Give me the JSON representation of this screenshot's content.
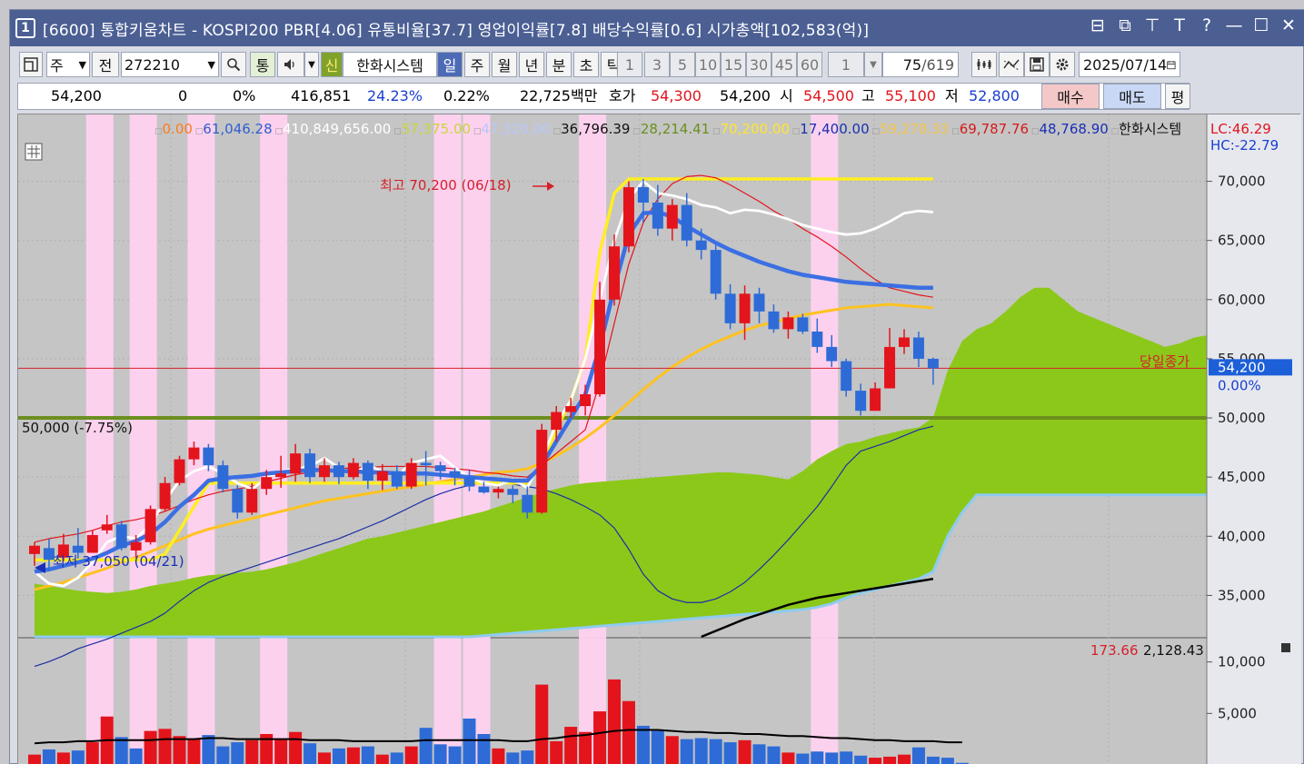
{
  "window": {
    "number": "1",
    "title": "[6600] 통합키움차트 - KOSPI200 PBR[4.06] 유통비율[37.7] 영업이익률[7.8] 배당수익률[0.6] 시가총액[102,583(억)]",
    "controls": [
      "⊟",
      "⧉",
      "⊤",
      "T",
      "?",
      "—",
      "☐",
      "✕"
    ]
  },
  "toolbar": {
    "period_label": "주",
    "prev_label": "전",
    "code_value": "272210",
    "tong_label": "통",
    "shin_label": "신",
    "company_name": "한화시스템",
    "periods": [
      "일",
      "주",
      "월",
      "년",
      "분",
      "초",
      "틱"
    ],
    "active_period": "일",
    "minute_options": [
      "1",
      "3",
      "5",
      "10",
      "15",
      "30",
      "45",
      "60"
    ],
    "count_value": "1",
    "page_position": "75",
    "page_total": "/619",
    "date_value": "2025/07/14"
  },
  "quote": {
    "price": "54,200",
    "change": "0",
    "change_pct": "0%",
    "volume": "416,851",
    "turnover_pct": "24.23%",
    "ratio_pct": "0.22%",
    "amount": "22,725백만",
    "ask_label": "호가",
    "ask_value": "54,300",
    "bid_value": "54,200",
    "open_label": "시",
    "open_value": "54,500",
    "high_label": "고",
    "high_value": "55,100",
    "low_label": "저",
    "low_value": "52,800",
    "buy_label": "매수",
    "sell_label": "매도",
    "even_label": "평"
  },
  "legend": {
    "items": [
      {
        "text": "0.00",
        "color": "#ff7b1c"
      },
      {
        "text": "61,046.28",
        "color": "#2f5fd0"
      },
      {
        "text": "410,849,656.00",
        "color": "#ffffff"
      },
      {
        "text": "57,375.00",
        "color": "#c9d63a"
      },
      {
        "text": "47,320.00",
        "color": "#b9c7ff"
      },
      {
        "text": "36,796.39",
        "color": "#111111"
      },
      {
        "text": "28,214.41",
        "color": "#6b8f1e"
      },
      {
        "text": "70,200.00",
        "color": "#ffe62b"
      },
      {
        "text": "17,400.00",
        "color": "#1a2fb5"
      },
      {
        "text": "59,278.33",
        "color": "#f2c44a"
      },
      {
        "text": "69,787.76",
        "color": "#d61a1a"
      },
      {
        "text": "48,768.90",
        "color": "#1a2fb5"
      },
      {
        "text": "한화시스템",
        "color": "#111111"
      }
    ],
    "lc": "LC:46.29",
    "hc": "HC:-22.79"
  },
  "annotations": {
    "high": "최고 70,200 (06/18)",
    "low": "최저 37,050 (04/21)",
    "level": "50,000 (-7.75%)",
    "close_label": "당일종가",
    "last_price": "54,200",
    "last_pct": "0.00%",
    "volume_legend_a": "173.66",
    "volume_legend_b": "2,128.43"
  },
  "axis": {
    "price_ticks": [
      "70,000",
      "65,000",
      "60,000",
      "55,000",
      "50,000",
      "45,000",
      "40,000",
      "35,000"
    ],
    "volume_ticks": [
      "10,000",
      "5,000"
    ]
  },
  "chart_data": {
    "type": "candlestick",
    "price_range": [
      31500,
      73500
    ],
    "volume_max": 12000,
    "candles": [
      [
        38500,
        39200,
        37500,
        39500
      ],
      [
        39000,
        38000,
        37050,
        39800
      ],
      [
        38200,
        39300,
        37900,
        40200
      ],
      [
        39200,
        38600,
        38100,
        40700
      ],
      [
        38600,
        40100,
        38600,
        40500
      ],
      [
        40500,
        41000,
        40200,
        41800
      ],
      [
        41000,
        39000,
        38800,
        41300
      ],
      [
        38800,
        39500,
        38200,
        40100
      ],
      [
        39500,
        42300,
        39300,
        42600
      ],
      [
        42300,
        44500,
        42100,
        45000
      ],
      [
        44500,
        46500,
        44300,
        46800
      ],
      [
        46500,
        47500,
        46000,
        48000
      ],
      [
        47500,
        46000,
        45500,
        47800
      ],
      [
        46000,
        44000,
        43700,
        46400
      ],
      [
        44000,
        42000,
        41500,
        44300
      ],
      [
        42000,
        44000,
        41800,
        44500
      ],
      [
        44000,
        45000,
        43500,
        45600
      ],
      [
        45000,
        45300,
        44100,
        46800
      ],
      [
        45300,
        47000,
        44600,
        47800
      ],
      [
        47000,
        45000,
        44500,
        47400
      ],
      [
        45000,
        46000,
        44600,
        46600
      ],
      [
        46000,
        45000,
        44400,
        46300
      ],
      [
        45000,
        46200,
        44800,
        46600
      ],
      [
        46200,
        44700,
        44000,
        46400
      ],
      [
        44700,
        45500,
        43900,
        46100
      ],
      [
        45500,
        44200,
        44000,
        46000
      ],
      [
        44200,
        46200,
        44000,
        46600
      ],
      [
        46200,
        46000,
        44300,
        47200
      ],
      [
        46000,
        45500,
        44800,
        46300
      ],
      [
        45500,
        45000,
        44300,
        45800
      ],
      [
        45000,
        44200,
        43800,
        45600
      ],
      [
        44200,
        43700,
        43600,
        44600
      ],
      [
        43700,
        44000,
        43200,
        44200
      ],
      [
        44000,
        43500,
        42800,
        44300
      ],
      [
        43500,
        42000,
        41500,
        44200
      ],
      [
        42000,
        49000,
        41900,
        49500
      ],
      [
        49000,
        50500,
        48000,
        51000
      ],
      [
        50500,
        51000,
        50000,
        51700
      ],
      [
        51000,
        52000,
        50200,
        52800
      ],
      [
        52000,
        60000,
        51800,
        61500
      ],
      [
        60000,
        64500,
        59500,
        65500
      ],
      [
        64500,
        69500,
        64000,
        70000
      ],
      [
        69500,
        68200,
        66500,
        70200
      ],
      [
        68200,
        66000,
        65400,
        69700
      ],
      [
        66000,
        68000,
        65000,
        68500
      ],
      [
        68000,
        65000,
        64500,
        69000
      ],
      [
        65000,
        64200,
        63400,
        66000
      ],
      [
        64200,
        60500,
        60000,
        64600
      ],
      [
        60500,
        58000,
        57500,
        61300
      ],
      [
        58000,
        60500,
        56600,
        61200
      ],
      [
        60500,
        59000,
        58000,
        61000
      ],
      [
        59000,
        57500,
        57200,
        59600
      ],
      [
        57500,
        58500,
        56700,
        59000
      ],
      [
        58500,
        57300,
        57100,
        58800
      ],
      [
        57300,
        56000,
        55500,
        58400
      ],
      [
        56000,
        54800,
        54300,
        57000
      ],
      [
        54800,
        52300,
        51800,
        55000
      ],
      [
        52300,
        50600,
        50200,
        52900
      ],
      [
        50600,
        52500,
        51000,
        53000
      ],
      [
        52500,
        56000,
        54700,
        57600
      ],
      [
        56000,
        56800,
        55400,
        57500
      ],
      [
        56800,
        55000,
        54300,
        57300
      ],
      [
        55000,
        54200,
        52800,
        55100
      ]
    ],
    "ma_red": [
      39500,
      39800,
      40000,
      40200,
      40500,
      40900,
      41200,
      41400,
      41700,
      42100,
      42600,
      43100,
      43500,
      43800,
      44000,
      44200,
      44600,
      44900,
      45200,
      45400,
      45600,
      45700,
      45800,
      45800,
      45900,
      45900,
      45900,
      45900,
      45800,
      45700,
      45600,
      45400,
      45300,
      45100,
      45000,
      46000,
      47000,
      48000,
      49000,
      53000,
      58000,
      63000,
      66500,
      68500,
      69800,
      70400,
      70500,
      70300,
      69700,
      69000,
      68300,
      67500,
      66800,
      66000,
      65300,
      64500,
      63600,
      62600,
      61700,
      61000,
      60700,
      60400,
      60200
    ],
    "ma_white": [
      37000,
      36000,
      35800,
      36500,
      37800,
      39500,
      40000,
      39800,
      41000,
      43000,
      44700,
      45500,
      45900,
      45300,
      44500,
      44000,
      44900,
      45500,
      45700,
      45900,
      46600,
      45800,
      45300,
      46000,
      45500,
      45100,
      46200,
      46500,
      46800,
      45800,
      45000,
      44500,
      44300,
      44800,
      44100,
      46500,
      49500,
      51500,
      55000,
      60000,
      65000,
      68500,
      70000,
      69000,
      68800,
      68500,
      68000,
      67800,
      67300,
      67600,
      67500,
      67200,
      66800,
      66300,
      66000,
      65700,
      65500,
      65600,
      66000,
      66600,
      67300,
      67500,
      67400
    ],
    "ma_blue": [
      37000,
      37200,
      37500,
      37800,
      38100,
      38600,
      39200,
      39600,
      40200,
      41200,
      42500,
      43500,
      44700,
      44900,
      45000,
      45100,
      45300,
      45400,
      45500,
      45600,
      45600,
      45500,
      45500,
      45400,
      45400,
      45300,
      45300,
      45300,
      45200,
      45100,
      45000,
      44900,
      44800,
      44700,
      44700,
      46000,
      48000,
      50000,
      52000,
      56000,
      61000,
      65500,
      67300,
      67400,
      67000,
      66200,
      65500,
      64800,
      64200,
      63700,
      63200,
      62800,
      62400,
      62100,
      61900,
      61700,
      61500,
      61400,
      61300,
      61200,
      61100,
      61000,
      61000
    ],
    "ma_orange": [
      35500,
      35800,
      36100,
      36500,
      36900,
      37300,
      37800,
      38200,
      38700,
      39200,
      39700,
      40200,
      40600,
      40900,
      41200,
      41500,
      41800,
      42100,
      42400,
      42700,
      43000,
      43200,
      43400,
      43600,
      43800,
      44000,
      44200,
      44400,
      44600,
      44800,
      45000,
      45200,
      45400,
      45500,
      45700,
      46200,
      46800,
      47500,
      48300,
      49200,
      50200,
      51300,
      52400,
      53400,
      54300,
      55100,
      55800,
      56400,
      56900,
      57400,
      57800,
      58100,
      58400,
      58700,
      58900,
      59100,
      59300,
      59400,
      59500,
      59600,
      59500,
      59400,
      59300
    ],
    "line_yellow": [
      38000,
      38000,
      38000,
      38000,
      38000,
      38000,
      38000,
      38000,
      38000,
      38500,
      40500,
      42500,
      44500,
      44500,
      44500,
      44500,
      44500,
      44500,
      44500,
      44500,
      44500,
      44500,
      44500,
      44500,
      44500,
      44500,
      44500,
      44500,
      44500,
      44500,
      44500,
      44500,
      44500,
      44500,
      44500,
      46000,
      49000,
      51500,
      55000,
      64000,
      69000,
      70200,
      70200,
      70200,
      70200,
      70200,
      70200,
      70200,
      70200,
      70200,
      70200,
      70200,
      70200,
      70200,
      70200,
      70200,
      70200,
      70200,
      70200,
      70200,
      70200,
      70200,
      70200
    ],
    "line_navy": [
      29000,
      29400,
      29900,
      30500,
      30900,
      31300,
      31800,
      32300,
      32800,
      33500,
      34500,
      35400,
      36100,
      36600,
      37000,
      37400,
      37800,
      38200,
      38600,
      39000,
      39400,
      39800,
      40300,
      40800,
      41300,
      41900,
      42500,
      43100,
      43600,
      44000,
      44300,
      44500,
      44500,
      44400,
      44200,
      44000,
      43600,
      43100,
      42500,
      41800,
      40700,
      38900,
      36800,
      35400,
      34700,
      34400,
      34400,
      34700,
      35300,
      36100,
      37200,
      38400,
      39700,
      41100,
      42500,
      44200,
      46000,
      47200,
      47600,
      48000,
      48500,
      49000,
      49300
    ],
    "line_black": [
      null,
      null,
      null,
      null,
      null,
      null,
      null,
      null,
      null,
      null,
      null,
      null,
      null,
      null,
      null,
      null,
      null,
      null,
      null,
      null,
      null,
      null,
      null,
      null,
      null,
      null,
      null,
      null,
      null,
      null,
      null,
      null,
      null,
      null,
      null,
      null,
      null,
      null,
      null,
      null,
      null,
      null,
      null,
      null,
      null,
      null,
      31500,
      32000,
      32500,
      33000,
      33400,
      33800,
      34200,
      34500,
      34800,
      35000,
      35200,
      35400,
      35600,
      35800,
      36000,
      36200,
      36400
    ],
    "cloud_top": [
      36000,
      35800,
      35600,
      35400,
      35300,
      35200,
      35300,
      35500,
      35800,
      36000,
      36200,
      36500,
      36700,
      36800,
      36900,
      37000,
      37200,
      37500,
      37800,
      38200,
      38600,
      39000,
      39400,
      39800,
      40000,
      40300,
      40600,
      40900,
      41200,
      41500,
      41800,
      42100,
      42500,
      42900,
      43300,
      43700,
      44000,
      44300,
      44500,
      44600,
      44700,
      44800,
      44900,
      45000,
      45100,
      45200,
      45300,
      45400,
      45400,
      45300,
      45200,
      45000,
      44800,
      45500,
      46500,
      47200,
      47800,
      48000,
      48400,
      48700,
      49000,
      49200,
      50000,
      54000,
      56500,
      57500,
      58000,
      59000,
      60200,
      61000,
      61000,
      60000,
      59000,
      58500,
      58000,
      57500,
      57000,
      56500,
      56000,
      56300,
      56800,
      57000,
      57200,
      57000,
      57300
    ],
    "cloud_bottom": [
      31500,
      31500,
      31500,
      31500,
      31500,
      31500,
      31500,
      31500,
      31500,
      31500,
      31500,
      31500,
      31500,
      31500,
      31500,
      31500,
      31500,
      31500,
      31500,
      31500,
      31500,
      31500,
      31500,
      31500,
      31500,
      31500,
      31500,
      31500,
      31500,
      31500,
      31500,
      31600,
      31700,
      31800,
      31900,
      32000,
      32100,
      32200,
      32300,
      32400,
      32500,
      32600,
      32700,
      32800,
      32900,
      33000,
      33100,
      33200,
      33300,
      33400,
      33500,
      33600,
      33700,
      33800,
      34000,
      34300,
      34800,
      35200,
      35500,
      35800,
      36100,
      36400,
      37000,
      40000,
      42000,
      43500,
      43500,
      43500,
      43500,
      43500,
      43500,
      43500,
      43500,
      43500,
      43500,
      43500,
      43500,
      43500,
      43500,
      43500,
      43500,
      43500,
      43500,
      43500,
      44000
    ],
    "volume": [
      1000,
      1500,
      1200,
      1400,
      2200,
      4700,
      2700,
      1600,
      3300,
      3500,
      2800,
      2500,
      2900,
      1800,
      2200,
      2400,
      3000,
      2500,
      3200,
      2100,
      1200,
      1600,
      1700,
      1800,
      1000,
      1200,
      1800,
      3600,
      2000,
      1800,
      4500,
      3000,
      1600,
      1200,
      1400,
      7800,
      2300,
      3700,
      3200,
      5200,
      8300,
      6200,
      3800,
      3300,
      2800,
      2500,
      2600,
      2500,
      2200,
      2400,
      2000,
      1800,
      1200,
      1100,
      1300,
      1200,
      1300,
      900,
      700,
      800,
      1000,
      1700,
      800,
      700,
      200
    ],
    "volume_ma": [
      2100,
      2200,
      2200,
      2300,
      2300,
      2400,
      2400,
      2400,
      2400,
      2500,
      2500,
      2500,
      2600,
      2600,
      2500,
      2500,
      2500,
      2500,
      2500,
      2400,
      2400,
      2400,
      2300,
      2300,
      2300,
      2300,
      2300,
      2400,
      2400,
      2400,
      2400,
      2400,
      2400,
      2300,
      2300,
      2500,
      2600,
      2800,
      2900,
      3100,
      3300,
      3400,
      3400,
      3400,
      3300,
      3200,
      3200,
      3100,
      3100,
      3000,
      3000,
      2900,
      2800,
      2800,
      2700,
      2600,
      2600,
      2500,
      2400,
      2400,
      2300,
      2300,
      2300,
      2200,
      2200
    ],
    "volume_up": [
      1,
      0,
      1,
      0,
      1,
      1,
      0,
      0,
      1,
      1,
      1,
      1,
      0,
      0,
      0,
      1,
      1,
      1,
      1,
      0,
      1,
      0,
      1,
      0,
      1,
      0,
      1,
      0,
      0,
      0,
      0,
      0,
      1,
      0,
      0,
      1,
      1,
      1,
      1,
      1,
      1,
      1,
      0,
      0,
      1,
      0,
      0,
      0,
      0,
      1,
      0,
      0,
      1,
      0,
      0,
      0,
      0,
      0,
      1,
      1,
      1,
      0,
      0,
      0,
      0
    ],
    "highlight_bars": [
      4,
      7,
      11,
      16,
      28,
      30,
      38,
      54,
      60,
      65,
      70,
      78,
      86,
      92,
      99,
      104
    ],
    "colors": {
      "up": "#e4141c",
      "down": "#2e6bd6",
      "ma_red": "#e4141c",
      "ma_white": "#ffffff",
      "ma_blue": "#3b6fe3",
      "ma_orange": "#ffc21f",
      "line_yellow": "#ffee22",
      "line_navy": "#1b2ea6",
      "line_black": "#000000",
      "cloud": "#8cc81a",
      "cloud_edge": "#8ecbf0",
      "highlight": "#ffd2f0",
      "level": "#6b8f1e",
      "last_price": "#d6202a",
      "axis_marker": "#1d5fd8"
    }
  }
}
